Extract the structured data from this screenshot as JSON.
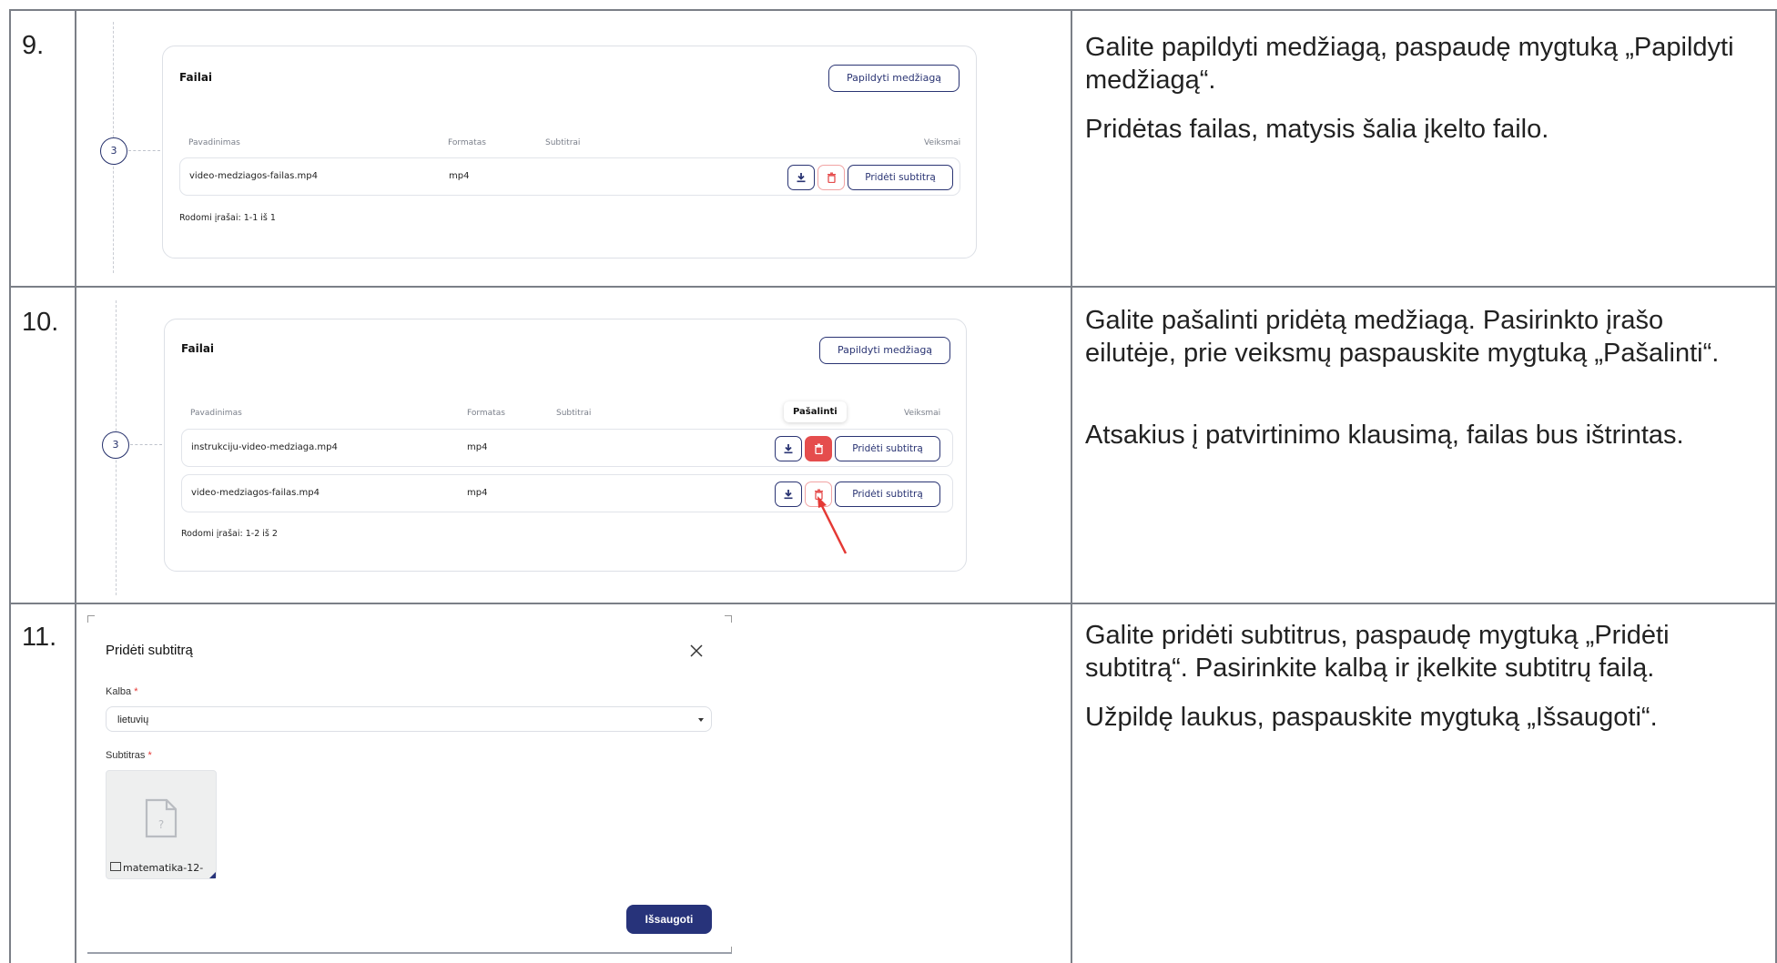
{
  "rows": [
    {
      "number": "9.",
      "description": [
        "Galite papildyti medžiagą, paspaudę mygtuką „Papildyti medžiagą“.",
        "Pridėtas failas, matysis šalia įkelto failo."
      ],
      "screenshot": {
        "step": "3",
        "card_title": "Failai",
        "add_button": "Papildyti medžiagą",
        "columns": [
          "Pavadinimas",
          "Formatas",
          "Subtitrai",
          "Veiksmai"
        ],
        "files": [
          {
            "name": "video-medziagos-failas.mp4",
            "format": "mp4",
            "action": "Pridėti subtitrą"
          }
        ],
        "footer": "Rodomi įrašai: 1-1 iš 1"
      }
    },
    {
      "number": "10.",
      "description": [
        "Galite pašalinti pridėtą medžiagą. Pasirinkto įrašo eilutėje, prie veiksmų paspauskite mygtuką „Pašalinti“.",
        "Atsakius į patvirtinimo klausimą, failas bus ištrintas."
      ],
      "screenshot": {
        "step": "3",
        "card_title": "Failai",
        "add_button": "Papildyti medžiagą",
        "columns": [
          "Pavadinimas",
          "Formatas",
          "Subtitrai",
          "Veiksmai"
        ],
        "tooltip": "Pašalinti",
        "files": [
          {
            "name": "instrukciju-video-medziaga.mp4",
            "format": "mp4",
            "action": "Pridėti subtitrą"
          },
          {
            "name": "video-medziagos-failas.mp4",
            "format": "mp4",
            "action": "Pridėti subtitrą"
          }
        ],
        "footer": "Rodomi įrašai: 1-2 iš 2"
      }
    },
    {
      "number": "11.",
      "description": [
        "Galite pridėti subtitrus, paspaudę mygtuką „Pridėti subtitrą“. Pasirinkite kalbą ir įkelkite subtitrų failą.",
        "Užpildę laukus, paspauskite mygtuką „Išsaugoti“."
      ],
      "modal": {
        "title": "Pridėti subtitrą",
        "language_label": "Kalba",
        "language_value": "lietuvių",
        "subtitle_label": "Subtitras",
        "required_mark": "*",
        "file_name": "matematika-12-",
        "save_button": "Išsaugoti"
      }
    }
  ],
  "colors": {
    "primary": "#27337a",
    "danger": "#e54d4d",
    "border": "#7b7f87"
  }
}
